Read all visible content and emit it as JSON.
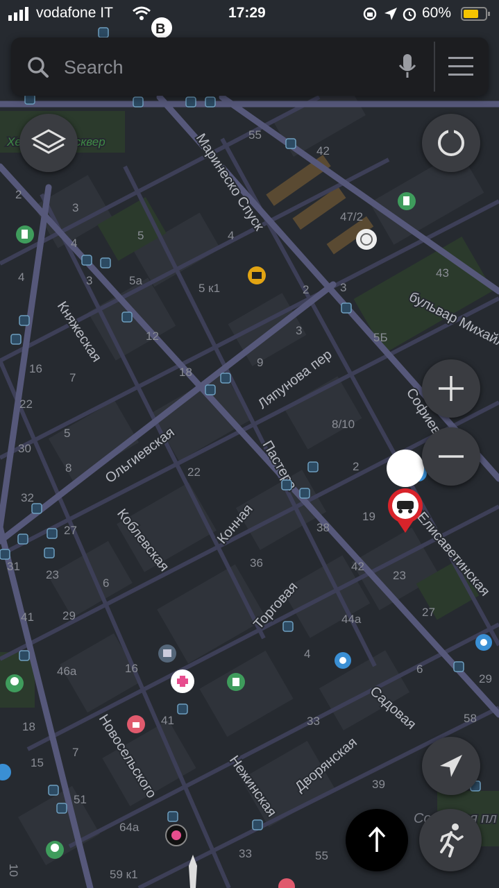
{
  "status_bar": {
    "carrier": "vodafone IT",
    "time": "17:29",
    "battery": "60%"
  },
  "search": {
    "placeholder": "Search"
  },
  "streets": {
    "marinesko": "Маринеско Спуск",
    "knyazheskaya": "Княжеская",
    "olgievskaya": "Ольгиевская",
    "koblevskaya": "Коблевская",
    "konnaya": "Конная",
    "pastera": "Пастера",
    "lyapunova": "Ляпунова пер",
    "torgovaya": "Торговая",
    "sofievskaya": "Софиевск",
    "elisavetinskaya": "Елисаветинская",
    "sadovaya": "Садовая",
    "dvoryanskaya": "Дворянская",
    "nezhinskaya": "Нежинская",
    "novoselskogo": "Новосельского",
    "bulvar": "бульвар Михайловский",
    "skver": "Херсонский сквер",
    "sobornaya": "Соборная пл"
  },
  "house_numbers": [
    "55",
    "42",
    "47/2",
    "2",
    "3",
    "5",
    "4",
    "4",
    "5a",
    "5 к1",
    "3",
    "43",
    "4",
    "2",
    "3",
    "5Б",
    "12",
    "18",
    "9",
    "3",
    "16",
    "7",
    "22",
    "30",
    "5",
    "8",
    "8/10",
    "2",
    "22",
    "32",
    "19",
    "27",
    "38",
    "23",
    "31",
    "42",
    "23",
    "6",
    "36",
    "27",
    "41",
    "29",
    "44a",
    "4",
    "16",
    "46a",
    "6",
    "18",
    "41",
    "33",
    "58",
    "7",
    "15",
    "39",
    "51",
    "64a",
    "55",
    "33",
    "10",
    "59 к1",
    "29"
  ],
  "colors": {
    "background": "#262a30",
    "block": "#2f333a",
    "road": "#3d3f57",
    "main_road": "#56587a",
    "park": "#2b3a2c",
    "accent_red": "#d8232a",
    "search_bg": "#1c1d20",
    "button_bg": "#3a3c41"
  },
  "icons": {
    "layers": "layers-icon",
    "compass": "compass-icon",
    "zoom_in": "plus-icon",
    "zoom_out": "minus-icon",
    "location": "navigation-arrow-icon",
    "route": "route-arrow-icon",
    "walk": "walking-person-icon",
    "search": "search-icon",
    "mic": "microphone-icon",
    "menu": "hamburger-menu-icon",
    "incident": "car-accident-icon"
  }
}
